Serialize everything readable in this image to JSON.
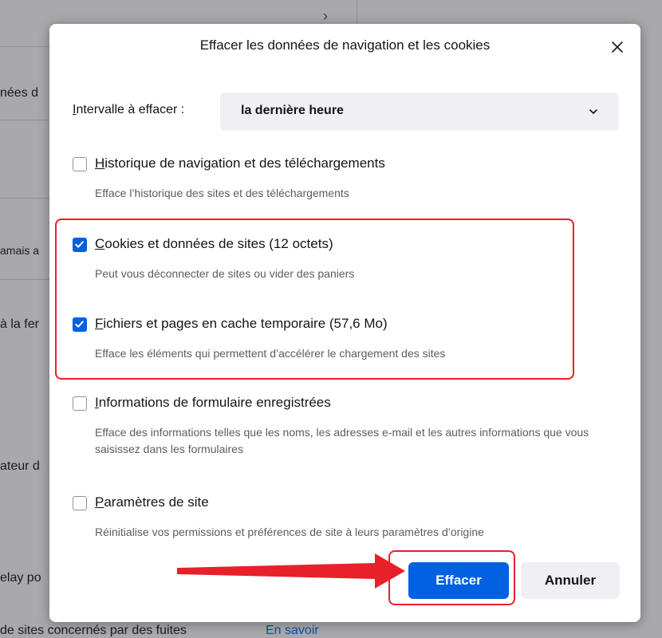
{
  "background_page": {
    "fragments": [
      "nées d",
      "amais a",
      "à la fer",
      "ateur d",
      "elay po",
      "de sites concernés par des fuites"
    ],
    "link": "En savoir"
  },
  "dialog": {
    "title": "Effacer les données de navigation et les cookies",
    "range": {
      "label_access": "I",
      "label_rest": "ntervalle à effacer :",
      "selected": "la dernière heure"
    },
    "options": [
      {
        "access": "H",
        "label_rest": "istorique de navigation et des téléchargements",
        "description": "Efface l’historique des sites et des téléchargements",
        "checked": false
      },
      {
        "access": "C",
        "label_rest": "ookies et données de sites (12 octets)",
        "description": "Peut vous déconnecter de sites ou vider des paniers",
        "checked": true
      },
      {
        "access": "F",
        "label_rest": "ichiers et pages en cache temporaire (57,6 Mo)",
        "description": "Efface les éléments qui permettent d’accélérer le chargement des sites",
        "checked": true
      },
      {
        "access": "I",
        "label_rest": "nformations de formulaire enregistrées",
        "description": "Efface des informations telles que les noms, les adresses e-mail et les autres informations que vous saisissez dans les formulaires",
        "checked": false
      },
      {
        "access": "P",
        "label_rest": "aramètres de site",
        "description": "Réinitialise vos permissions et préférences de site à leurs paramètres d’origine",
        "checked": false
      }
    ],
    "buttons": {
      "confirm": "Effacer",
      "cancel": "Annuler"
    }
  },
  "colors": {
    "accent": "#0061e0",
    "annotation": "#e8202a",
    "overlay": "#a9a9ad"
  },
  "icons": {
    "close": "close-icon",
    "dropdown": "chevron-down-icon",
    "checkmark": "checkmark-icon",
    "annotation_arrow": "arrow-right-icon"
  }
}
